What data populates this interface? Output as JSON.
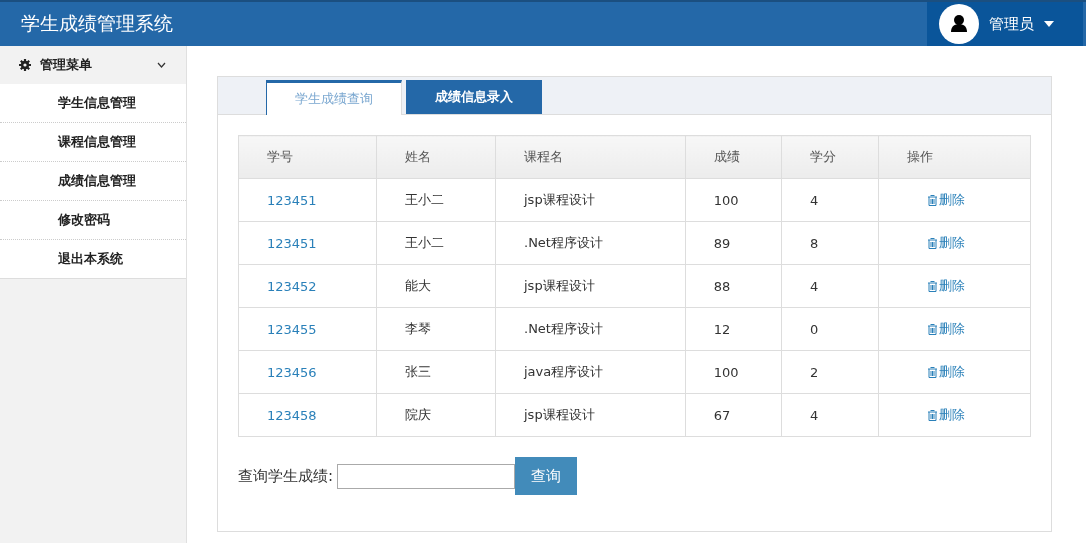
{
  "header": {
    "title": "学生成绩管理系统",
    "user": "管理员"
  },
  "sidebar": {
    "title": "管理菜单",
    "expanded": true,
    "items": [
      {
        "label": "学生信息管理"
      },
      {
        "label": "课程信息管理"
      },
      {
        "label": "成绩信息管理"
      },
      {
        "label": "修改密码"
      },
      {
        "label": "退出本系统"
      }
    ]
  },
  "tabs": [
    {
      "label": "学生成绩查询",
      "selected": true
    },
    {
      "label": "成绩信息录入",
      "selected": false
    }
  ],
  "table": {
    "columns": [
      "学号",
      "姓名",
      "课程名",
      "成绩",
      "学分",
      "操作"
    ],
    "rows": [
      {
        "id": "123451",
        "name": "王小二",
        "course": "jsp课程设计",
        "score": "100",
        "credit": "4",
        "action": "删除"
      },
      {
        "id": "123451",
        "name": "王小二",
        "course": ".Net程序设计",
        "score": "89",
        "credit": "8",
        "action": "删除"
      },
      {
        "id": "123452",
        "name": "能大",
        "course": "jsp课程设计",
        "score": "88",
        "credit": "4",
        "action": "删除"
      },
      {
        "id": "123455",
        "name": "李琴",
        "course": ".Net程序设计",
        "score": "12",
        "credit": "0",
        "action": "删除"
      },
      {
        "id": "123456",
        "name": "张三",
        "course": "java程序设计",
        "score": "100",
        "credit": "2",
        "action": "删除"
      },
      {
        "id": "123458",
        "name": "院庆",
        "course": "jsp课程设计",
        "score": "67",
        "credit": "4",
        "action": "删除"
      }
    ]
  },
  "search": {
    "label": "查询学生成绩:",
    "button": "查询"
  }
}
